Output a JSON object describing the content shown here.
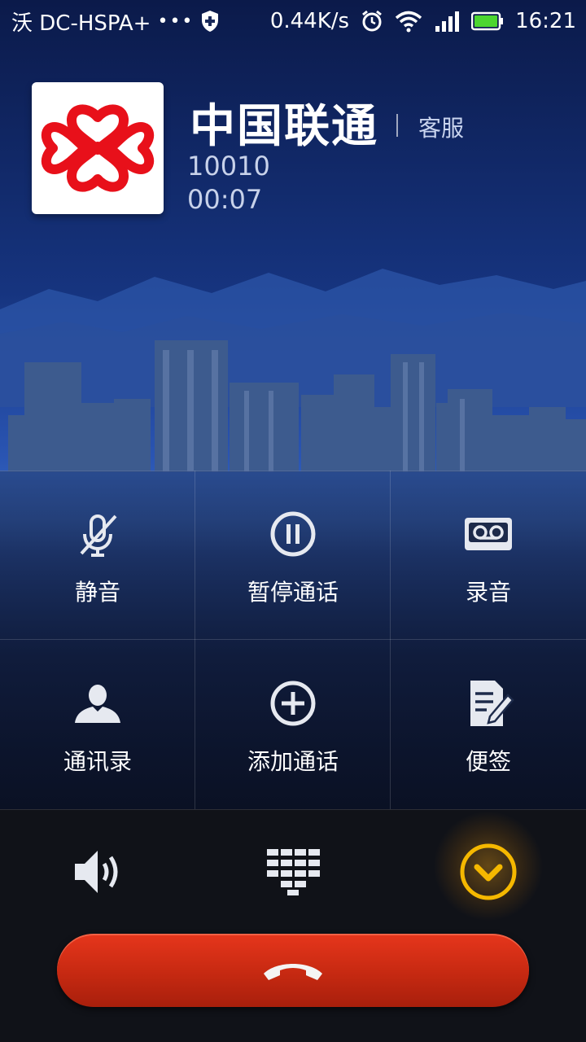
{
  "status_bar": {
    "carrier": "沃 DC-HSPA+",
    "dots": "•••",
    "network_speed": "0.44K/s",
    "time": "16:21",
    "icons": [
      "shield-icon",
      "alarm-icon",
      "wifi-icon",
      "signal-icon",
      "battery-icon"
    ]
  },
  "caller": {
    "name": "中国联通",
    "tag": "客服",
    "number": "10010",
    "duration": "00:07",
    "avatar_icon": "china-unicom-logo"
  },
  "actions": [
    {
      "label": "静音",
      "icon": "mute-mic-icon"
    },
    {
      "label": "暂停通话",
      "icon": "pause-icon"
    },
    {
      "label": "录音",
      "icon": "record-tape-icon"
    },
    {
      "label": "通讯录",
      "icon": "contacts-icon"
    },
    {
      "label": "添加通话",
      "icon": "add-call-icon"
    },
    {
      "label": "便签",
      "icon": "note-icon"
    }
  ],
  "bottom": {
    "speaker_icon": "speaker-icon",
    "dialpad_icon": "dialpad-icon",
    "collapse_icon": "chevron-down-circle-icon",
    "end_call_icon": "hangup-icon"
  },
  "colors": {
    "end_call": "#d02c14",
    "collapse_accent": "#f5b800"
  }
}
